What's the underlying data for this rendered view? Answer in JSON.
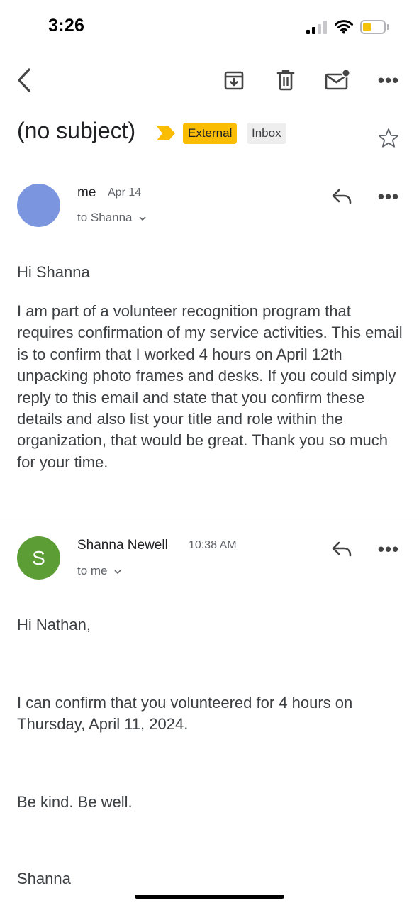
{
  "status_bar": {
    "time": "3:26",
    "battery_color": "#f4c20d"
  },
  "toolbar": {
    "icons": [
      "back-arrow-icon",
      "archive-icon",
      "trash-icon",
      "mark-unread-icon",
      "more-icon"
    ]
  },
  "subject": {
    "text": "(no subject)",
    "chips": [
      "External",
      "Inbox"
    ],
    "external_chip_color": "#fbbc04",
    "importance_marker_color": "#fbbc04"
  },
  "messages": [
    {
      "sender": "me",
      "date": "Apr 14",
      "to": "to Shanna",
      "avatar_color": "#7b96de",
      "avatar_letter": "",
      "greeting": "Hi Shanna",
      "body": "I am part of a volunteer recognition program that requires confirmation of my service activities. This email is to confirm that I worked 4 hours on April 12th unpacking photo frames and desks. If you could simply reply to this email and state that you confirm these details and also list your title and role within the organization, that would be great. Thank you so much for your time."
    },
    {
      "sender": "Shanna Newell",
      "date": "10:38 AM",
      "to": "to me",
      "avatar_color": "#5c9d35",
      "avatar_letter": "S",
      "greeting": "Hi Nathan,",
      "body": "I can confirm that you volunteered for 4 hours on Thursday, April 11, 2024.",
      "closing": "Be kind. Be well.",
      "signature": "Shanna"
    }
  ]
}
